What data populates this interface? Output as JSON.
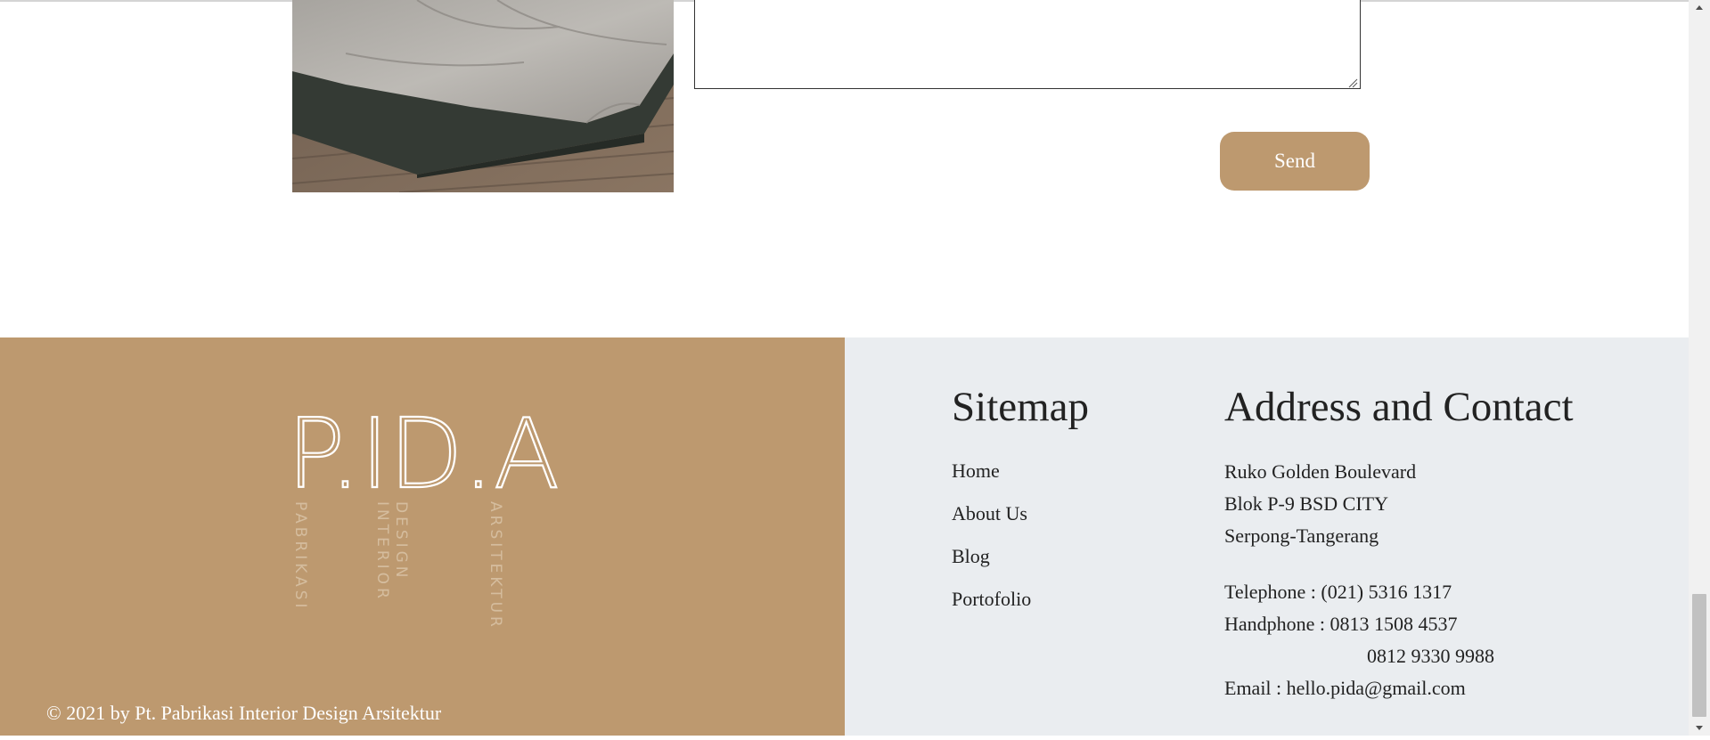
{
  "contact_form": {
    "message_value": "",
    "send_label": "Send"
  },
  "footer": {
    "logo": {
      "wordmark": "P.ID.A",
      "words": [
        "PABRIKASI",
        "INTERIOR",
        "DESIGN",
        "ARSITEKTUR"
      ]
    },
    "copyright": "© 2021 by Pt. Pabrikasi Interior Design Arsitektur",
    "sitemap": {
      "title": "Sitemap",
      "links": [
        "Home",
        "About Us",
        "Blog",
        "Portofolio"
      ]
    },
    "contact": {
      "title": "Address and Contact",
      "address": [
        "Ruko Golden Boulevard",
        "Blok P-9 BSD CITY",
        "Serpong-Tangerang"
      ],
      "telephone": "Telephone : (021) 5316 1317",
      "handphone": "Handphone : 0813 1508 4537",
      "handphone_2": "0812 9330 9988",
      "email": "Email : hello.pida@gmail.com"
    }
  },
  "colors": {
    "accent": "#bd996f",
    "footer_right_bg": "#eaedf0"
  },
  "icons": {
    "resize_grip": "resize-grip-icon",
    "scroll_up": "chevron-up-icon",
    "scroll_down": "chevron-down-icon"
  }
}
